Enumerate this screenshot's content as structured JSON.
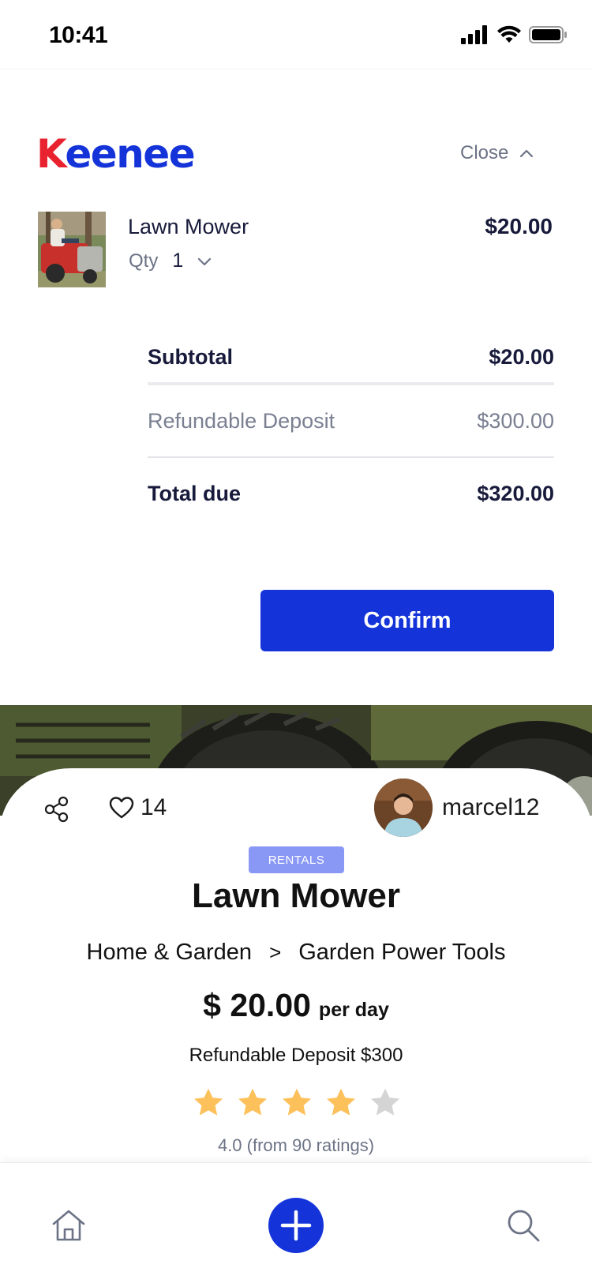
{
  "status_bar": {
    "time": "10:41"
  },
  "checkout": {
    "brand": {
      "first_letter": "K",
      "rest": "eenee"
    },
    "close_label": "Close",
    "item": {
      "name": "Lawn Mower",
      "price": "$20.00",
      "qty_label": "Qty",
      "qty_value": "1"
    },
    "summary": {
      "subtotal_label": "Subtotal",
      "subtotal_value": "$20.00",
      "deposit_label": "Refundable Deposit",
      "deposit_value": "$300.00",
      "total_label": "Total due",
      "total_value": "$320.00"
    },
    "confirm_label": "Confirm"
  },
  "product": {
    "like_count": "14",
    "owner_username": "marcel12",
    "badge": "RENTALS",
    "title": "Lawn Mower",
    "category": "Home & Garden",
    "category_separator": ">",
    "subcategory": "Garden Power Tools",
    "price": "$ 20.00",
    "price_unit": "per day",
    "deposit_note": "Refundable Deposit $300",
    "rating_value": 4,
    "rating_max": 5,
    "rating_text": "4.0 (from 90 ratings)"
  },
  "icons": {
    "status": [
      "signal-icon",
      "wifi-icon",
      "battery-icon"
    ],
    "nav": [
      "home-icon",
      "plus-icon",
      "search-icon"
    ]
  },
  "colors": {
    "brand_blue": "#1434d9",
    "brand_red": "#e8232f",
    "badge_bg": "#8a98f5",
    "star_filled": "#fdc15b",
    "star_empty": "#d4d4d4",
    "muted_text": "#6c7386"
  }
}
